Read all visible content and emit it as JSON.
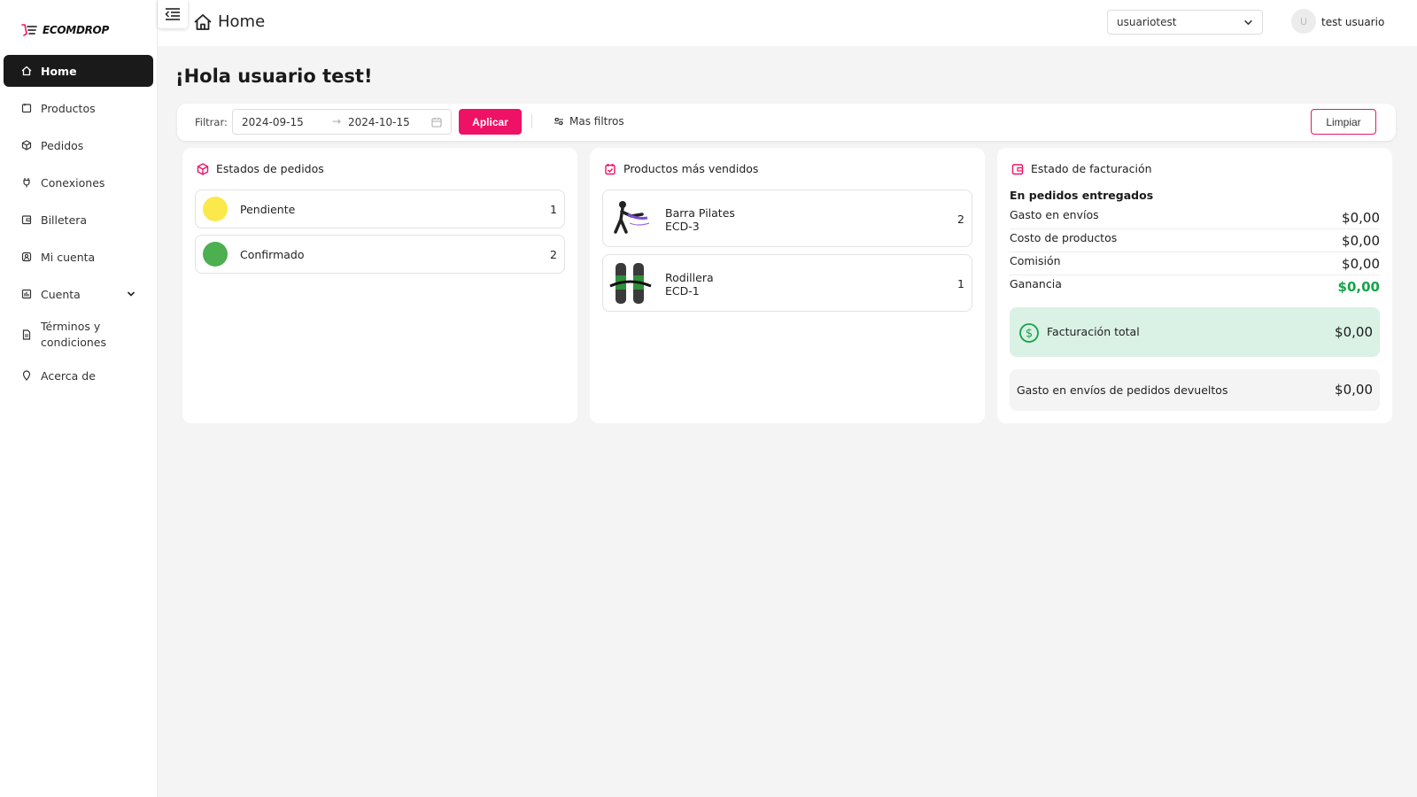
{
  "app": {
    "brand": "ECOMDROP",
    "accent": "#ee1266"
  },
  "sidebar": {
    "items": [
      {
        "label": "Home",
        "icon": "home-icon",
        "active": true
      },
      {
        "label": "Productos",
        "icon": "box-icon"
      },
      {
        "label": "Pedidos",
        "icon": "package-icon"
      },
      {
        "label": "Conexiones",
        "icon": "plug-icon"
      },
      {
        "label": "Billetera",
        "icon": "wallet-icon"
      },
      {
        "label": "Mi cuenta",
        "icon": "user-icon"
      },
      {
        "label": "Cuenta",
        "icon": "chart-icon",
        "expandable": true
      },
      {
        "label": "Términos y condiciones",
        "icon": "document-icon"
      },
      {
        "label": "Acerca de",
        "icon": "location-pin-icon"
      }
    ]
  },
  "header": {
    "title": "Home",
    "user_select": "usuariotest",
    "avatar_initial": "U",
    "user_name": "test usuario"
  },
  "main": {
    "greeting": "¡Hola usuario test!",
    "filters": {
      "label": "Filtrar:",
      "start_date": "2024-09-15",
      "end_date": "2024-10-15",
      "apply_label": "Aplicar",
      "more_label": "Mas filtros",
      "clear_label": "Limpiar"
    },
    "order_status": {
      "title": "Estados de pedidos",
      "items": [
        {
          "label": "Pendiente",
          "count": "1",
          "color": "#fbe84a"
        },
        {
          "label": "Confirmado",
          "count": "2",
          "color": "#4caf50"
        }
      ]
    },
    "top_products": {
      "title": "Productos más vendidos",
      "items": [
        {
          "name": "Barra Pilates",
          "sku": "ECD-3",
          "count": "2"
        },
        {
          "name": "Rodillera",
          "sku": "ECD-1",
          "count": "1"
        }
      ]
    },
    "billing": {
      "title": "Estado de facturación",
      "section_label": "En pedidos entregados",
      "rows": [
        {
          "label": "Gasto en envíos",
          "value": "$0,00"
        },
        {
          "label": "Costo de productos",
          "value": "$0,00"
        },
        {
          "label": "Comisión",
          "value": "$0,00"
        },
        {
          "label": "Ganancia",
          "value": "$0,00"
        }
      ],
      "total_label": "Facturación total",
      "total_value": "$0,00",
      "returns_label": "Gasto en envíos de pedidos devueltos",
      "returns_value": "$0,00",
      "profit_color": "#17a34a"
    }
  }
}
